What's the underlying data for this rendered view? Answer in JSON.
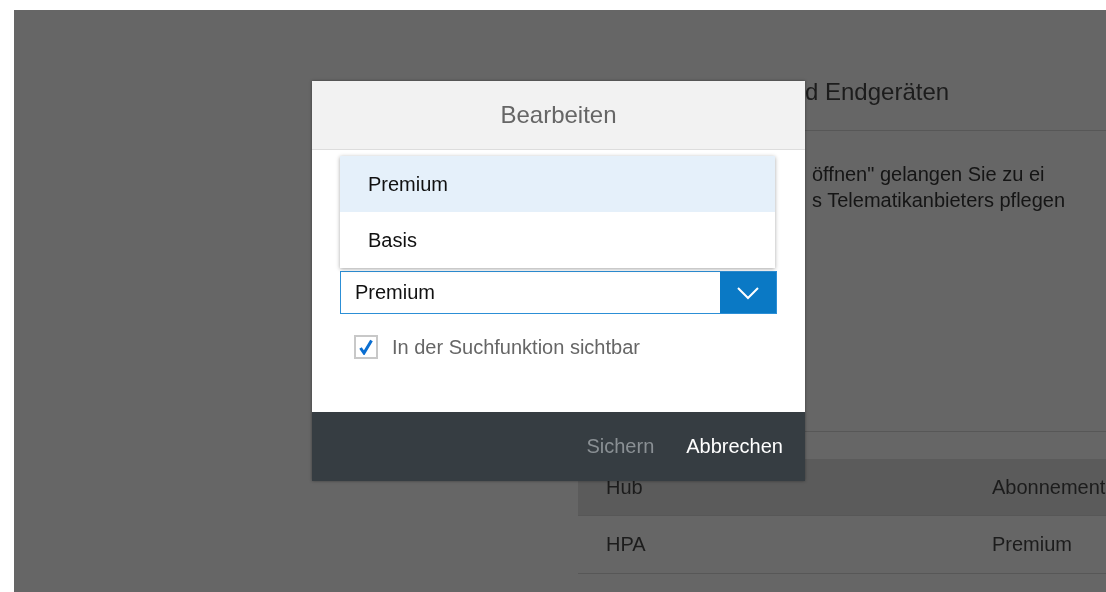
{
  "background_page": {
    "heading": "d Endgeräten",
    "paragraph_lines": [
      "öffnen\" gelangen Sie zu ei",
      "s Telematikanbieters pflegen"
    ],
    "table": {
      "columns": [
        "Hub",
        "Abonnement"
      ],
      "rows": [
        [
          "HPA",
          "Premium"
        ]
      ]
    }
  },
  "dialog": {
    "title": "Bearbeiten",
    "dropdown": {
      "expanded": true,
      "value": "Premium",
      "options": [
        {
          "label": "Premium",
          "selected": true
        },
        {
          "label": "Basis",
          "selected": false
        }
      ]
    },
    "checkbox": {
      "label": "In der Suchfunktion sichtbar",
      "checked": true
    },
    "buttons": [
      {
        "label": "Sichern",
        "disabled": true
      },
      {
        "label": "Abbrechen",
        "disabled": false
      }
    ]
  }
}
